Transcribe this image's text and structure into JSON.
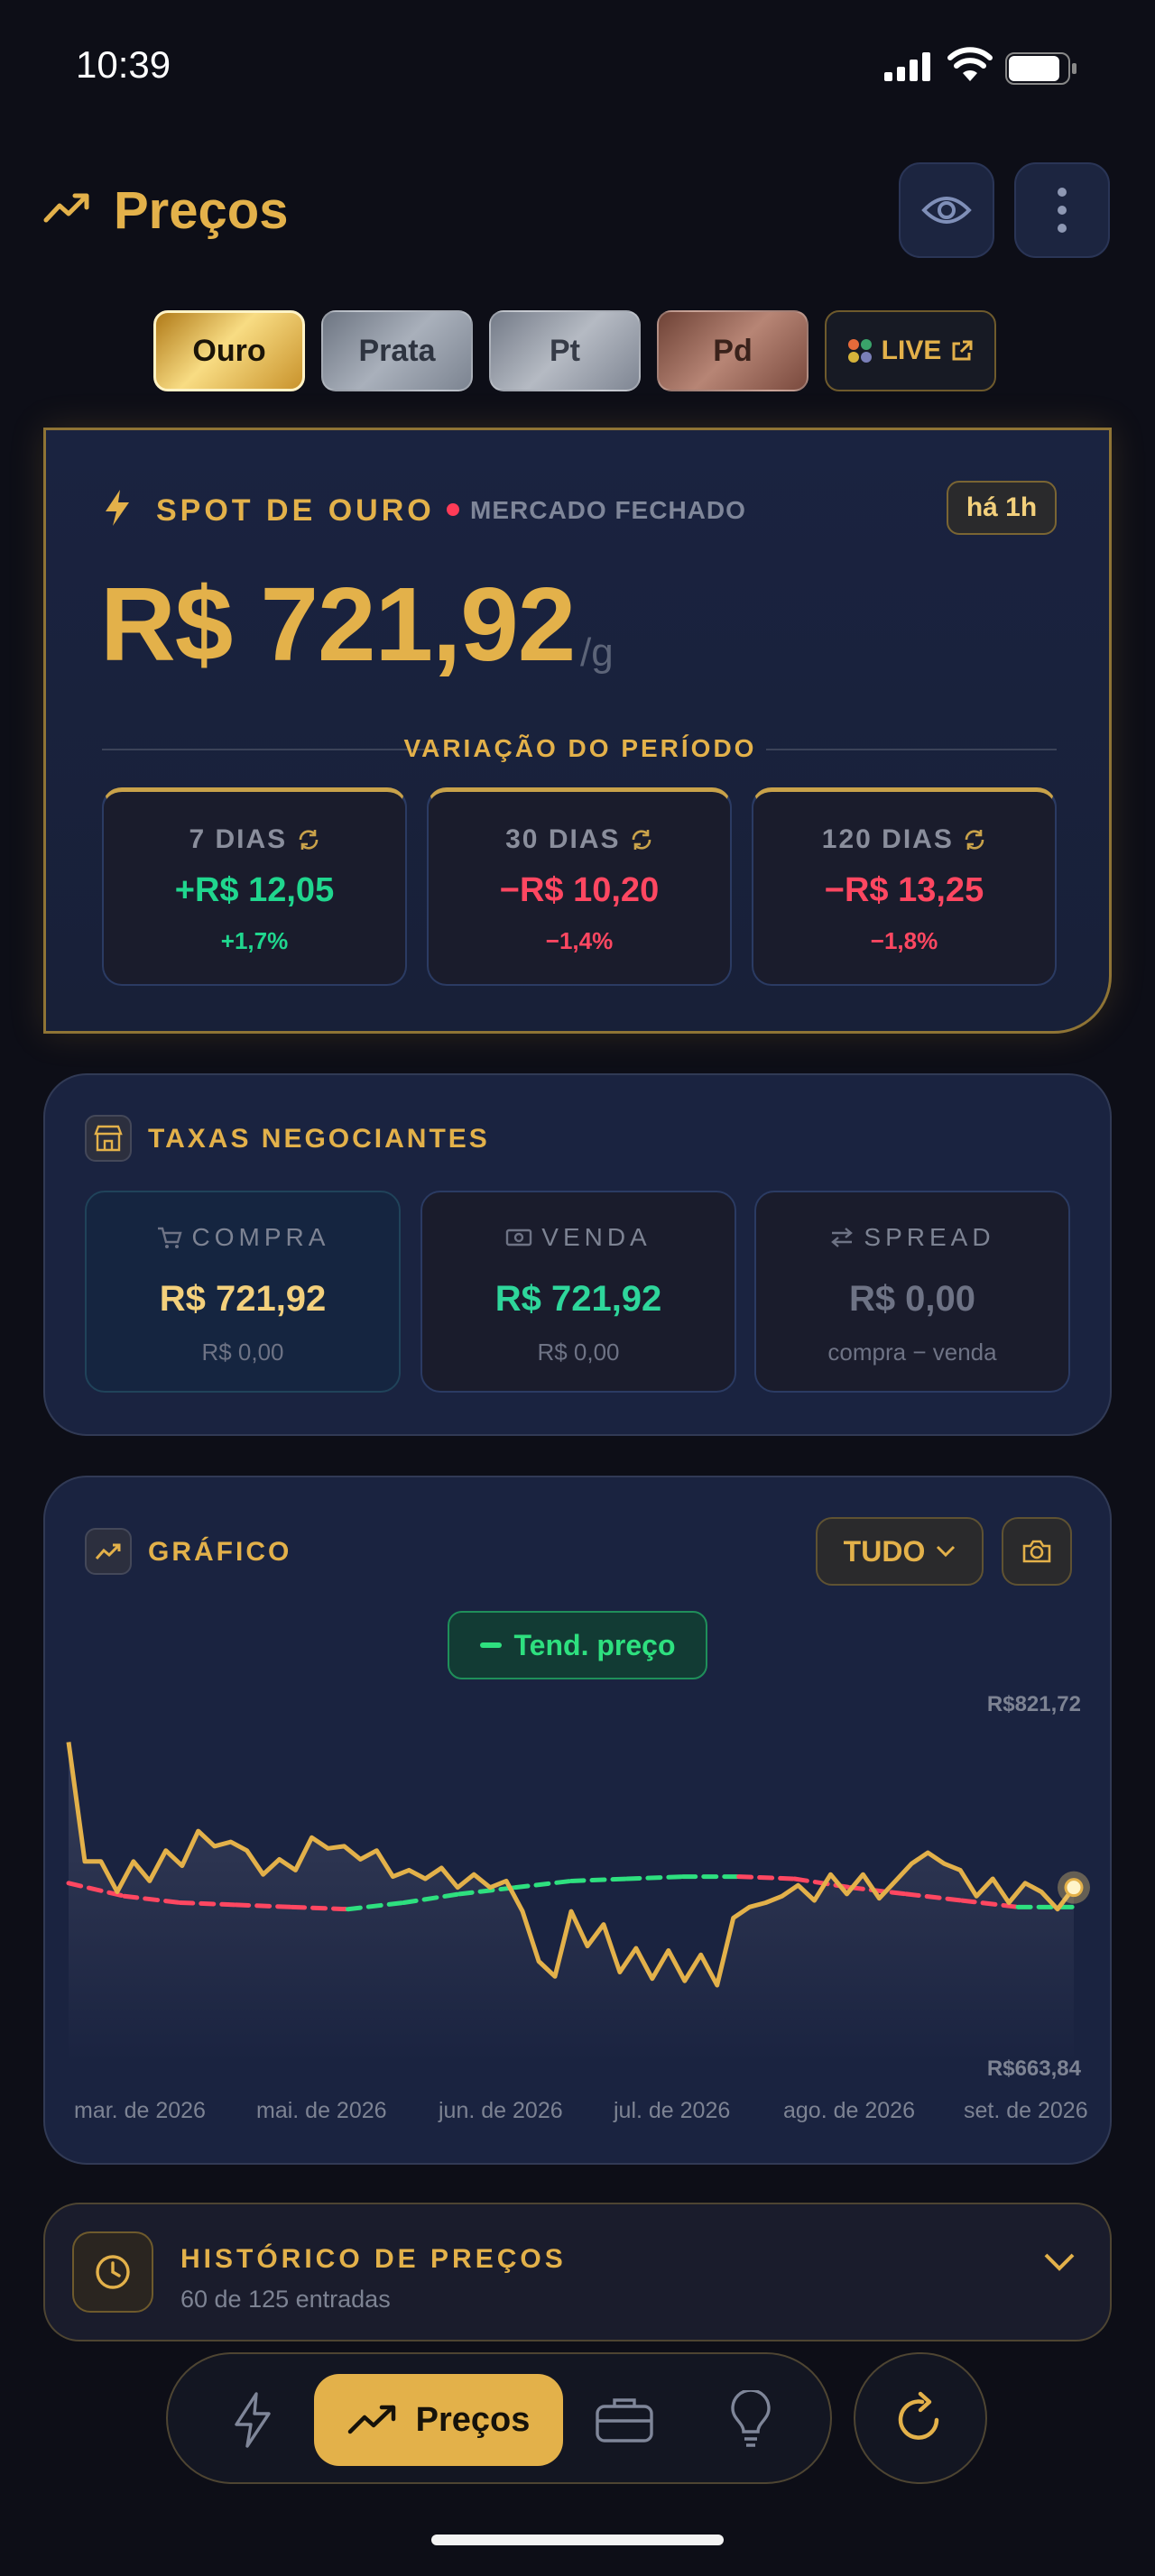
{
  "status_bar": {
    "time": "10:39"
  },
  "header": {
    "title": "Preços"
  },
  "metals": [
    {
      "label": "Ouro",
      "selected": true
    },
    {
      "label": "Prata",
      "selected": false
    },
    {
      "label": "Pt",
      "selected": false
    },
    {
      "label": "Pd",
      "selected": false
    }
  ],
  "live_button": {
    "label": "LIVE"
  },
  "spot": {
    "label": "SPOT DE OURO",
    "market_status": "MERCADO FECHADO",
    "updated": "há 1h",
    "price": "R$ 721,92",
    "unit": "/g",
    "variation_title": "VARIAÇÃO DO PERÍODO",
    "periods": [
      {
        "label": "7 DIAS",
        "value": "+R$ 12,05",
        "pct": "+1,7%",
        "direction": "up"
      },
      {
        "label": "30 DIAS",
        "value": "−R$ 10,20",
        "pct": "−1,4%",
        "direction": "down"
      },
      {
        "label": "120 DIAS",
        "value": "−R$ 13,25",
        "pct": "−1,8%",
        "direction": "down"
      }
    ]
  },
  "fees": {
    "title": "TAXAS NEGOCIANTES",
    "buy": {
      "label": "COMPRA",
      "value": "R$ 721,92",
      "sub": "R$ 0,00"
    },
    "sell": {
      "label": "VENDA",
      "value": "R$ 721,92",
      "sub": "R$ 0,00"
    },
    "spread": {
      "label": "SPREAD",
      "value": "R$ 0,00",
      "sub": "compra − venda"
    }
  },
  "chart": {
    "title": "GRÁFICO",
    "range": "TUDO",
    "legend": "Tend. preço",
    "y_max_label": "R$821,72",
    "y_min_label": "R$663,84",
    "x_labels": [
      "mar. de 2026",
      "mai. de 2026",
      "jun. de 2026",
      "jul. de 2026",
      "ago. de 2026",
      "set. de 2026"
    ]
  },
  "chart_data": {
    "type": "line",
    "ylim": [
      663.84,
      821.72
    ],
    "x_ticks": [
      "mar. de 2026",
      "mai. de 2026",
      "jun. de 2026",
      "jul. de 2026",
      "ago. de 2026",
      "set. de 2026"
    ],
    "series": [
      {
        "name": "",
        "color": "#e3b14a",
        "values": [
          812,
          757,
          757,
          743,
          757,
          748,
          762,
          755,
          771,
          764,
          766,
          762,
          751,
          758,
          753,
          768,
          763,
          764,
          758,
          762,
          750,
          753,
          749,
          754,
          745,
          751,
          745,
          748,
          734,
          711,
          704,
          734,
          718,
          728,
          706,
          717,
          703,
          716,
          702,
          714,
          700,
          731,
          736,
          738,
          741,
          746,
          739,
          751,
          742,
          751,
          740,
          748,
          756,
          761,
          756,
          753,
          741,
          749,
          738,
          747,
          743,
          735,
          745
        ]
      },
      {
        "name": "Tend. preço",
        "color": "#2ee07f",
        "values": [
          747,
          741,
          738,
          737,
          736,
          735,
          738,
          742,
          745,
          748,
          749,
          750,
          750,
          749,
          745,
          742,
          739,
          736,
          736
        ]
      }
    ],
    "colors": {
      "gold": "#e3b14a",
      "trend_up": "#2ee07f",
      "trend_down": "#ff4761"
    }
  },
  "history": {
    "title": "HISTÓRICO DE PREÇOS",
    "subtitle": "60 de 125 entradas"
  },
  "nav": {
    "active_label": "Preços",
    "items": [
      "flash-icon",
      "trend-icon",
      "briefcase-icon",
      "bulb-icon"
    ]
  }
}
